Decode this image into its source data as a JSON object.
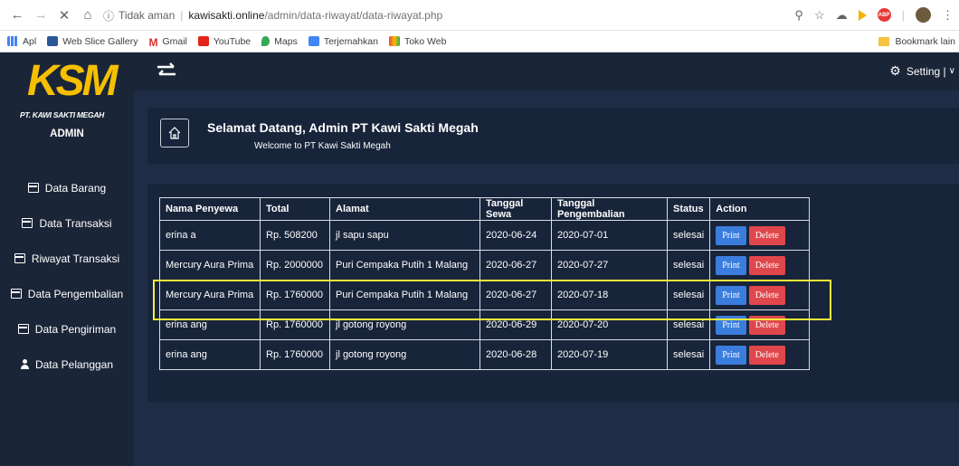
{
  "browser": {
    "security_label": "Tidak aman",
    "url_host": "kawisakti.online",
    "url_path": "/admin/data-riwayat/data-riwayat.php",
    "bookmarks": [
      {
        "label": "Apl"
      },
      {
        "label": "Web Slice Gallery"
      },
      {
        "label": "Gmail"
      },
      {
        "label": "YouTube"
      },
      {
        "label": "Maps"
      },
      {
        "label": "Terjemahkan"
      },
      {
        "label": "Toko Web"
      }
    ],
    "bookmark_other": "Bookmark lain",
    "ext_badge": "ABP"
  },
  "sidebar": {
    "logo_text": "KSM",
    "logo_subtitle": "PT. KAWI SAKTI MEGAH",
    "role": "ADMIN",
    "items": [
      {
        "label": "Data Barang"
      },
      {
        "label": "Data Transaksi"
      },
      {
        "label": "Riwayat Transaksi"
      },
      {
        "label": "Data Pengembalian"
      },
      {
        "label": "Data Pengiriman"
      },
      {
        "label": "Data Pelanggan"
      }
    ]
  },
  "topbar": {
    "setting_label": "Setting |"
  },
  "welcome": {
    "title": "Selamat Datang, Admin PT Kawi Sakti Megah",
    "subtitle": "Welcome to PT Kawi Sakti Megah"
  },
  "table": {
    "headers": [
      "Nama Penyewa",
      "Total",
      "Alamat",
      "Tanggal Sewa",
      "Tanggal Pengembalian",
      "Status",
      "Action"
    ],
    "print_label": "Print",
    "delete_label": "Delete",
    "rows": [
      {
        "nama": "erina a",
        "total": "Rp. 508200",
        "alamat": "jl sapu sapu",
        "tgl_sewa": "2020-06-24",
        "tgl_kembali": "2020-07-01",
        "status": "selesai"
      },
      {
        "nama": "Mercury Aura Prima",
        "total": "Rp. 2000000",
        "alamat": "Puri Cempaka Putih 1 Malang",
        "tgl_sewa": "2020-06-27",
        "tgl_kembali": "2020-07-27",
        "status": "selesai"
      },
      {
        "nama": "Mercury Aura Prima",
        "total": "Rp. 1760000",
        "alamat": "Puri Cempaka Putih 1 Malang",
        "tgl_sewa": "2020-06-27",
        "tgl_kembali": "2020-07-18",
        "status": "selesai"
      },
      {
        "nama": "erina ang",
        "total": "Rp. 1760000",
        "alamat": "jl gotong royong",
        "tgl_sewa": "2020-06-29",
        "tgl_kembali": "2020-07-20",
        "status": "selesai"
      },
      {
        "nama": "erina ang",
        "total": "Rp. 1760000",
        "alamat": "jl gotong royong",
        "tgl_sewa": "2020-06-28",
        "tgl_kembali": "2020-07-19",
        "status": "selesai"
      }
    ]
  },
  "colors": {
    "sidebar_bg": "#1b2538",
    "content_bg": "#1e2d45",
    "print_btn": "#3b7ddd",
    "delete_btn": "#e0474c",
    "highlight": "#f3f03a",
    "logo": "#f6c000"
  }
}
